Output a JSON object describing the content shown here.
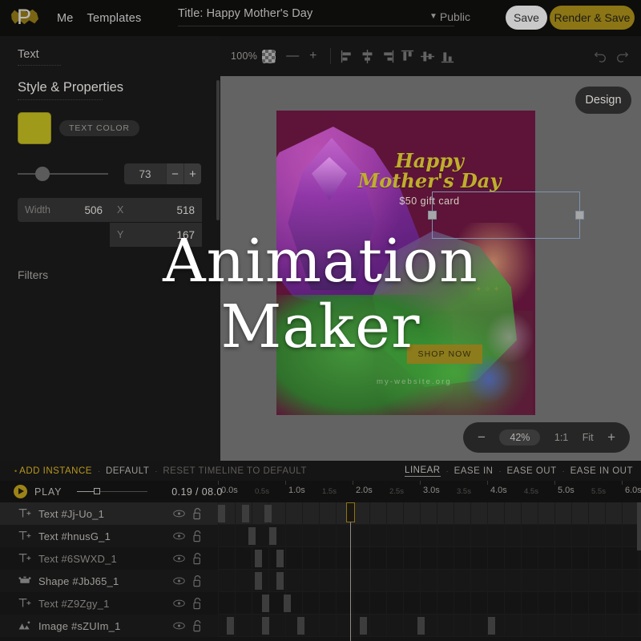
{
  "topbar": {
    "logo_letter": "P",
    "nav": [
      {
        "label": "Me"
      },
      {
        "label": "Templates"
      }
    ],
    "title_label": "Title: Happy Mother's Day",
    "visibility": "Public",
    "visibility_caret": "▼",
    "save_label": "Save",
    "render_label": "Render & Save"
  },
  "sidebar": {
    "section_text": "Text",
    "section_style": "Style & Properties",
    "text_color_label": "TEXT COLOR",
    "swatch_color": "#a09a1b",
    "size_value": "73",
    "minus": "−",
    "plus": "+",
    "fields": {
      "width_label": "Width",
      "width_value": "506",
      "x_label": "X",
      "x_value": "518",
      "y_label": "Y",
      "y_value": "167"
    },
    "section_filters": "Filters"
  },
  "toolbar": {
    "zoom_label": "100%",
    "minus": "—",
    "plus": "+",
    "align_icons": [
      "align-left-icon",
      "align-center-horizontal-icon",
      "align-right-icon",
      "align-top-icon",
      "align-middle-vertical-icon",
      "align-bottom-icon"
    ],
    "undo_icon": "undo-icon",
    "redo_icon": "redo-icon"
  },
  "canvas": {
    "design_button": "Design",
    "artboard": {
      "heading_line1": "Happy",
      "heading_line2": "Mother's Day",
      "subheading": "$50 gift card",
      "cta_label": "SHOP NOW",
      "website": "my-website.org",
      "bg_color": "#5d1438",
      "accent_color": "#bfae2c"
    },
    "zoom_bar": {
      "minus": "−",
      "percent": "42%",
      "one_to_one": "1:1",
      "fit": "Fit",
      "plus": "+"
    }
  },
  "overlay": {
    "line1": "Animation",
    "line2": "Maker"
  },
  "timeline": {
    "header": {
      "bullet": "•",
      "add_instance": "ADD INSTANCE",
      "sep": "·",
      "default": "DEFAULT",
      "reset": "RESET TIMELINE TO DEFAULT",
      "easing": [
        {
          "label": "LINEAR",
          "active": true
        },
        {
          "label": "EASE IN",
          "active": false
        },
        {
          "label": "EASE OUT",
          "active": false
        },
        {
          "label": "EASE IN OUT",
          "active": false
        }
      ]
    },
    "controls": {
      "play_label": "PLAY",
      "time_code": "0.19 / 08.0"
    },
    "ruler_major": [
      "0.0s",
      "1.0s",
      "2.0s",
      "3.0s",
      "4.0s",
      "5.0s",
      "6.0s"
    ],
    "ruler_minor": [
      "0.5s",
      "1.5s",
      "2.5s",
      "3.5s",
      "4.5s",
      "5.5s"
    ],
    "layers": [
      {
        "name": "Text #Jj-Uo_1",
        "icon": "text-layer-icon",
        "selected": true,
        "keyframes": [
          0,
          30,
          58
        ]
      },
      {
        "name": "Text #hnusG_1",
        "icon": "text-layer-icon",
        "selected": false,
        "keyframes": [
          38,
          64
        ]
      },
      {
        "name": "Text #6SWXD_1",
        "icon": "text-layer-icon",
        "selected": false,
        "keyframes": [
          46,
          73
        ]
      },
      {
        "name": "Shape #JbJ65_1",
        "icon": "shape-layer-icon",
        "selected": false,
        "keyframes": [
          46,
          73
        ]
      },
      {
        "name": "Text #Z9Zgy_1",
        "icon": "text-layer-icon",
        "selected": false,
        "keyframes": [
          55,
          82
        ]
      },
      {
        "name": "Image #sZUIm_1",
        "icon": "image-layer-icon",
        "selected": false,
        "keyframes": [
          11,
          55,
          99,
          177,
          249,
          337
        ]
      }
    ]
  }
}
